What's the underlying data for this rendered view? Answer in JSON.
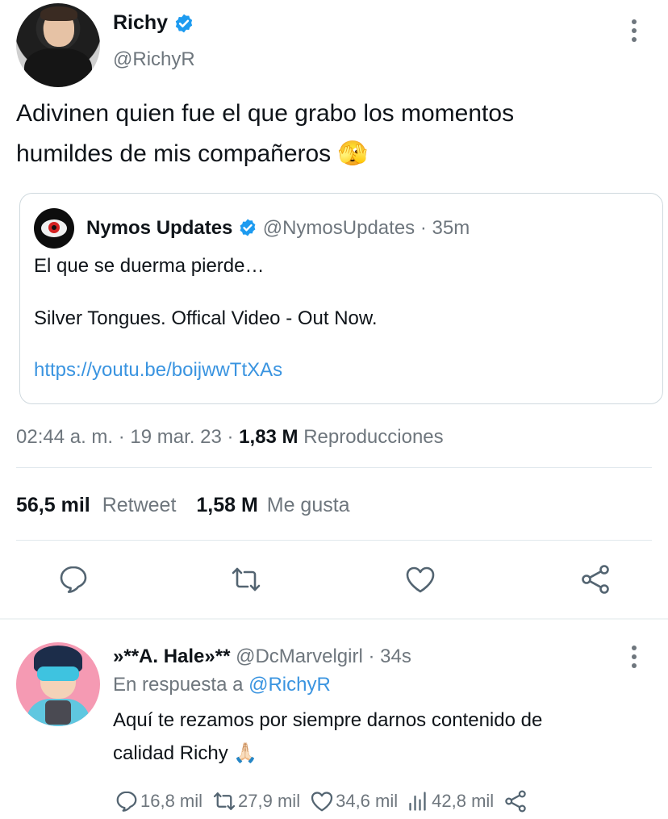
{
  "tweet": {
    "author_name": "Richy",
    "author_handle": "@RichyR",
    "text_line1": "Adivinen quien fue el que grabo los momentos",
    "text_line2": "humildes de mis compañeros",
    "emoji": "🫣",
    "quote": {
      "name": "Nymos Updates",
      "handle": "@NymosUpdates",
      "sep": "·",
      "time": "35m",
      "line1": "El que se duerma pierde…",
      "line2": "Silver Tongues. Offical Video - Out Now.",
      "link": "https://youtu.be/boijwwTtXAs"
    },
    "time": "02:44 a. m.",
    "sep1": "·",
    "date": "19 mar. 23",
    "sep2": "·",
    "views_count": "1,83 M",
    "views_label": "Reproducciones",
    "retweets_count": "56,5 mil",
    "retweets_label": "Retweet",
    "likes_count": "1,58 M",
    "likes_label": "Me gusta"
  },
  "actions": [
    "reply-icon",
    "retweet-icon",
    "heart-icon",
    "share-icon"
  ],
  "reply": {
    "name": "»**A. Hale»**",
    "handle": "@DcMarvelgirl",
    "sep": "·",
    "time": "34s",
    "in_reply_prefix": "En respuesta a",
    "in_reply_handle": "@RichyR",
    "text_line1": "Aquí te rezamos por siempre darnos contenido de",
    "text_line2": "calidad Richy",
    "emoji": "🙏🏻",
    "replies": "16,8 mil",
    "retweets": "27,9 mil",
    "likes": "34,6 mil",
    "views": "42,8 mil"
  },
  "colors": {
    "accent": "#1d9bf0",
    "link": "#3a94e0",
    "muted": "#6e767d",
    "divider": "#e1e8ed"
  }
}
